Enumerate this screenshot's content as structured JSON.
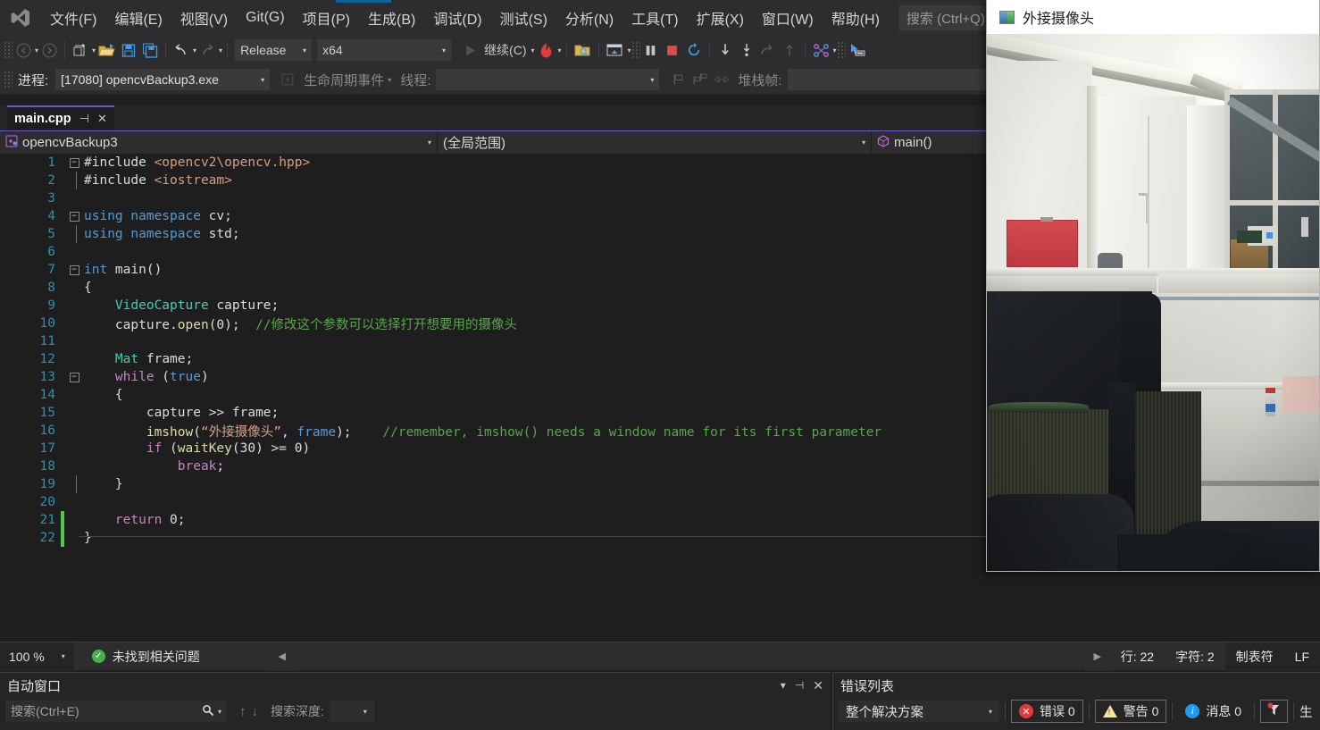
{
  "menu": {
    "logo_icon": "visual-studio-logo",
    "items": [
      {
        "label": "文件(F)"
      },
      {
        "label": "编辑(E)"
      },
      {
        "label": "视图(V)"
      },
      {
        "label": "Git(G)"
      },
      {
        "label": "项目(P)"
      },
      {
        "label": "生成(B)"
      },
      {
        "label": "调试(D)"
      },
      {
        "label": "测试(S)"
      },
      {
        "label": "分析(N)"
      },
      {
        "label": "工具(T)"
      },
      {
        "label": "扩展(X)"
      },
      {
        "label": "窗口(W)"
      },
      {
        "label": "帮助(H)"
      }
    ],
    "search_placeholder": "搜索 (Ctrl+Q)"
  },
  "toolbar": {
    "nav_back_icon": "arrow-back-icon",
    "nav_forward_icon": "arrow-forward-icon",
    "new_item_icon": "new-item-icon",
    "open_icon": "open-folder-icon",
    "save_icon": "save-icon",
    "save_all_icon": "save-all-icon",
    "undo_icon": "undo-icon",
    "redo_icon": "redo-icon",
    "configuration": "Release",
    "platform": "x64",
    "continue_label": "继续(C)",
    "continue_icon": "play-icon",
    "hot_reload_icon": "hot-reload-flame-icon",
    "attach_icon": "attach-to-process-icon",
    "windows_icon": "debug-windows-icon",
    "break_all_icon": "pause-icon",
    "stop_icon": "stop-icon",
    "restart_icon": "restart-icon",
    "step_into_icon": "step-into-icon",
    "step_over_icon": "step-over-icon",
    "step_out_icon": "step-out-icon",
    "step_up_icon": "step-up-icon",
    "threads_icon": "threads-icon",
    "cursor_icon": "select-cursor-icon"
  },
  "debugbar": {
    "process_label": "进程:",
    "process_value": "[17080] opencvBackup3.exe",
    "lifecycle_icon": "lifecycle-icon",
    "lifecycle_label": "生命周期事件",
    "thread_label": "线程:",
    "thread_value": "",
    "flag_icon": "flag-icon",
    "flags_icon": "flags-icon",
    "link_icon": "link-icon",
    "stackframe_label": "堆栈帧:",
    "stackframe_value": ""
  },
  "tab": {
    "label": "main.cpp",
    "pin_icon": "pin-icon",
    "close_icon": "close-icon"
  },
  "navbar": {
    "project_icon": "cpp-project-icon",
    "project": "opencvBackup3",
    "scope": "(全局范围)",
    "member_icon": "method-cube-icon",
    "member": "main()"
  },
  "editor": {
    "lines": [
      {
        "n": 1,
        "fold": "minus",
        "change": "none",
        "tokens": [
          {
            "t": "#include ",
            "c": "k-plain"
          },
          {
            "t": "<opencv2\\opencv.hpp>",
            "c": "k-str"
          }
        ]
      },
      {
        "n": 2,
        "fold": "endline",
        "change": "none",
        "tokens": [
          {
            "t": "#include ",
            "c": "k-plain"
          },
          {
            "t": "<iostream>",
            "c": "k-str"
          }
        ]
      },
      {
        "n": 3,
        "fold": "none",
        "change": "none",
        "tokens": []
      },
      {
        "n": 4,
        "fold": "minus",
        "change": "none",
        "tokens": [
          {
            "t": "using namespace",
            "c": "k-blue"
          },
          {
            "t": " cv;",
            "c": "k-plain"
          }
        ]
      },
      {
        "n": 5,
        "fold": "endline",
        "change": "none",
        "tokens": [
          {
            "t": "using namespace",
            "c": "k-blue"
          },
          {
            "t": " std;",
            "c": "k-plain"
          }
        ]
      },
      {
        "n": 6,
        "fold": "none",
        "change": "none",
        "tokens": []
      },
      {
        "n": 7,
        "fold": "minus",
        "change": "none",
        "tokens": [
          {
            "t": "int",
            "c": "k-blue"
          },
          {
            "t": " main()",
            "c": "k-plain"
          }
        ]
      },
      {
        "n": 8,
        "fold": "none",
        "change": "none",
        "tokens": [
          {
            "t": "{",
            "c": "k-plain"
          }
        ]
      },
      {
        "n": 9,
        "fold": "none",
        "change": "none",
        "tokens": [
          {
            "t": "    ",
            "c": "k-plain"
          },
          {
            "t": "VideoCapture",
            "c": "k-type"
          },
          {
            "t": " capture;",
            "c": "k-plain"
          }
        ]
      },
      {
        "n": 10,
        "fold": "none",
        "change": "none",
        "tokens": [
          {
            "t": "    capture.",
            "c": "k-plain"
          },
          {
            "t": "open",
            "c": "k-fn"
          },
          {
            "t": "(",
            "c": "k-plain"
          },
          {
            "t": "0",
            "c": "k-plain"
          },
          {
            "t": ");  ",
            "c": "k-plain"
          },
          {
            "t": "//修改这个参数可以选择打开想要用的摄像头",
            "c": "k-green"
          }
        ]
      },
      {
        "n": 11,
        "fold": "none",
        "change": "none",
        "tokens": []
      },
      {
        "n": 12,
        "fold": "none",
        "change": "none",
        "tokens": [
          {
            "t": "    ",
            "c": "k-plain"
          },
          {
            "t": "Mat",
            "c": "k-type"
          },
          {
            "t": " frame;",
            "c": "k-plain"
          }
        ]
      },
      {
        "n": 13,
        "fold": "minus",
        "change": "none",
        "tokens": [
          {
            "t": "    ",
            "c": "k-plain"
          },
          {
            "t": "while",
            "c": "k-purple"
          },
          {
            "t": " (",
            "c": "k-plain"
          },
          {
            "t": "true",
            "c": "k-blue"
          },
          {
            "t": ")",
            "c": "k-plain"
          }
        ]
      },
      {
        "n": 14,
        "fold": "none",
        "change": "none",
        "tokens": [
          {
            "t": "    {",
            "c": "k-plain"
          }
        ]
      },
      {
        "n": 15,
        "fold": "none",
        "change": "none",
        "tokens": [
          {
            "t": "        capture ",
            "c": "k-plain"
          },
          {
            "t": ">>",
            "c": "k-plain"
          },
          {
            "t": " frame;",
            "c": "k-plain"
          }
        ]
      },
      {
        "n": 16,
        "fold": "none",
        "change": "none",
        "tokens": [
          {
            "t": "        ",
            "c": "k-plain"
          },
          {
            "t": "imshow",
            "c": "k-fn"
          },
          {
            "t": "(",
            "c": "k-plain"
          },
          {
            "t": "“外接摄像头”",
            "c": "k-str"
          },
          {
            "t": ", ",
            "c": "k-plain"
          },
          {
            "t": "frame",
            "c": "k-blue"
          },
          {
            "t": ");    ",
            "c": "k-plain"
          },
          {
            "t": "//remember, imshow() needs a window name for its first parameter",
            "c": "k-green"
          }
        ]
      },
      {
        "n": 17,
        "fold": "none",
        "change": "none",
        "tokens": [
          {
            "t": "        ",
            "c": "k-plain"
          },
          {
            "t": "if",
            "c": "k-purple"
          },
          {
            "t": " (",
            "c": "k-plain"
          },
          {
            "t": "waitKey",
            "c": "k-fn"
          },
          {
            "t": "(",
            "c": "k-plain"
          },
          {
            "t": "30",
            "c": "k-plain"
          },
          {
            "t": ") >= ",
            "c": "k-plain"
          },
          {
            "t": "0",
            "c": "k-plain"
          },
          {
            "t": ")",
            "c": "k-plain"
          }
        ]
      },
      {
        "n": 18,
        "fold": "none",
        "change": "none",
        "tokens": [
          {
            "t": "            ",
            "c": "k-plain"
          },
          {
            "t": "break",
            "c": "k-purple"
          },
          {
            "t": ";",
            "c": "k-plain"
          }
        ]
      },
      {
        "n": 19,
        "fold": "endline",
        "change": "none",
        "tokens": [
          {
            "t": "    }",
            "c": "k-plain"
          }
        ]
      },
      {
        "n": 20,
        "fold": "none",
        "change": "none",
        "tokens": []
      },
      {
        "n": 21,
        "fold": "none",
        "change": "green",
        "tokens": [
          {
            "t": "    ",
            "c": "k-plain"
          },
          {
            "t": "return",
            "c": "k-purple"
          },
          {
            "t": " ",
            "c": "k-plain"
          },
          {
            "t": "0",
            "c": "k-plain"
          },
          {
            "t": ";",
            "c": "k-plain"
          }
        ]
      },
      {
        "n": 22,
        "fold": "none",
        "change": "green",
        "tokens": [
          {
            "t": "}",
            "c": "k-plain"
          }
        ]
      }
    ]
  },
  "editor_status": {
    "zoom": "100 %",
    "issues_icon": "check-circle-icon",
    "issues_text": "未找到相关问题",
    "prev_icon": "prev-arrow-icon",
    "next_icon": "next-arrow-icon",
    "line": "行: 22",
    "col": "字符: 2",
    "tabs": "制表符",
    "eol": "LF"
  },
  "autos_panel": {
    "title": "自动窗口",
    "chevron_icon": "chevron-down-icon",
    "pin_icon": "pin-icon",
    "close_icon": "close-icon",
    "search_placeholder": "搜索(Ctrl+E)",
    "search_icon": "search-icon",
    "search_caret_icon": "caret-down-icon",
    "up_icon": "arrow-up-icon",
    "down_icon": "arrow-down-icon",
    "depth_label": "搜索深度:",
    "depth_value": ""
  },
  "errors_panel": {
    "title": "错误列表",
    "scope": "整个解决方案",
    "errors": "错误 0",
    "warnings": "警告 0",
    "messages": "消息 0",
    "filter_icon": "error-filter-icon",
    "build_label": "生"
  },
  "camera_window": {
    "title": "外接摄像头",
    "icon": "opencv-window-icon"
  },
  "colors": {
    "accent": "#0e639c",
    "tab_accent": "#6a5acd",
    "error_red": "#e03a3a",
    "warn_yellow": "#f6e3a1",
    "info_blue": "#1e9bf0",
    "comment_green": "#57a64a",
    "string_orange": "#d69d85",
    "keyword_blue": "#569cd6"
  }
}
